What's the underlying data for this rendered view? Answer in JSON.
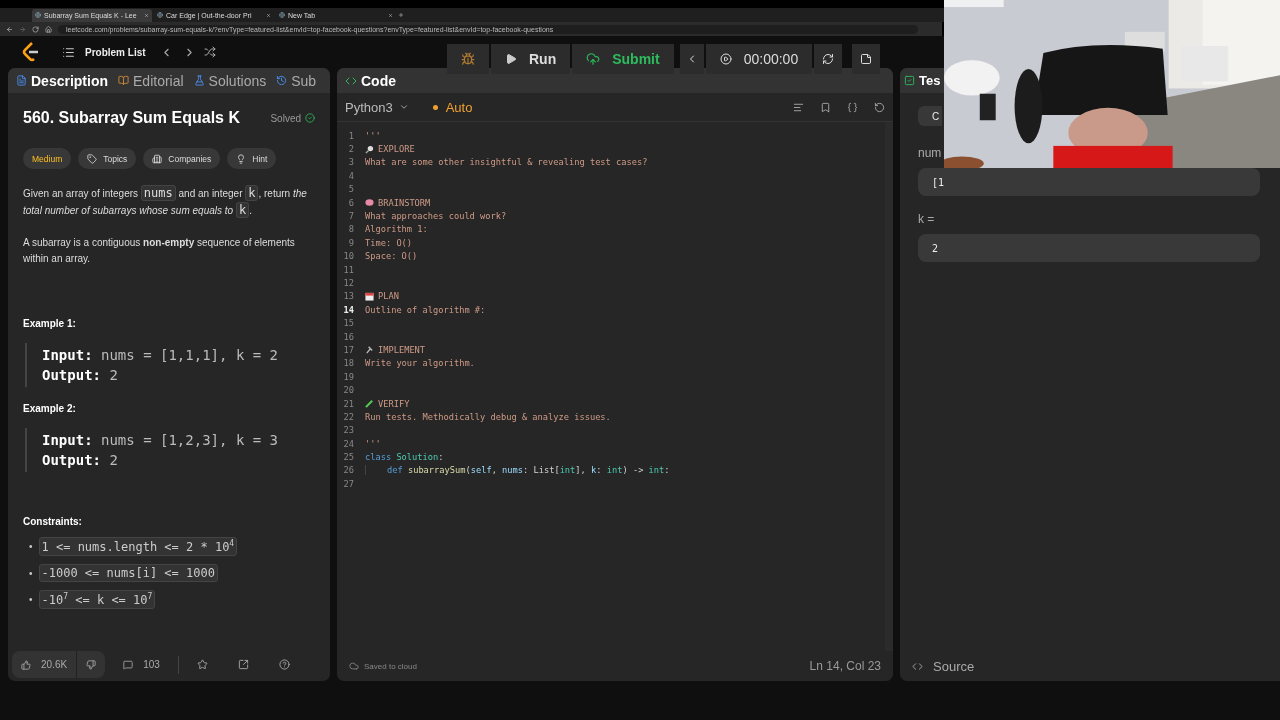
{
  "browser": {
    "tabs": [
      {
        "title": "Subarray Sum Equals K - Lee",
        "selected": true
      },
      {
        "title": "Car Edge | Out-the-door Pri",
        "selected": false
      },
      {
        "title": "New Tab",
        "selected": false
      }
    ],
    "url": "leetcode.com/problems/subarray-sum-equals-k/?envType=featured-list&envId=top-facebook-questions?envType=featured-list&envId=top-facebook-questions"
  },
  "header": {
    "problem_list": "Problem List"
  },
  "toolbar": {
    "run": "Run",
    "submit": "Submit",
    "timer": "00:00:00"
  },
  "description_panel": {
    "tabs": [
      {
        "label": "Description",
        "selected": true
      },
      {
        "label": "Editorial",
        "selected": false
      },
      {
        "label": "Solutions",
        "selected": false
      },
      {
        "label": "Sub",
        "selected": false
      }
    ],
    "title": "560. Subarray Sum Equals K",
    "status": "Solved",
    "tags": [
      {
        "label": "Medium",
        "kind": "difficulty"
      },
      {
        "label": "Topics",
        "kind": "topics"
      },
      {
        "label": "Companies",
        "kind": "companies"
      },
      {
        "label": "Hint",
        "kind": "hint"
      }
    ],
    "paragraphs": [
      [
        {
          "text": "Given an array of integers ",
          "kind": "text"
        },
        {
          "text": "nums",
          "kind": "code"
        },
        {
          "text": " and an integer ",
          "kind": "text"
        },
        {
          "text": "k",
          "kind": "code"
        },
        {
          "text": ", return ",
          "kind": "text"
        },
        {
          "text": "the total number of subarrays whose sum equals to ",
          "kind": "italic"
        },
        {
          "text": "k",
          "kind": "code"
        },
        {
          "text": ".",
          "kind": "text"
        }
      ],
      [
        {
          "text": "A subarray is a contiguous ",
          "kind": "text"
        },
        {
          "text": "non-empty",
          "kind": "bold"
        },
        {
          "text": " sequence of elements within an array.",
          "kind": "text"
        }
      ]
    ],
    "examples": [
      {
        "heading": "Example 1:",
        "input_label": "Input:",
        "input": "nums = [1,1,1], k = 2",
        "output_label": "Output:",
        "output": "2"
      },
      {
        "heading": "Example 2:",
        "input_label": "Input:",
        "input": "nums = [1,2,3], k = 3",
        "output_label": "Output:",
        "output": "2"
      }
    ],
    "constraints_heading": "Constraints:",
    "constraints": [
      {
        "bullet": "•",
        "text": "1 <= nums.length <= 2 * 10$^{4}$"
      },
      {
        "bullet": "•",
        "text": "-1000 <= nums[i] <= 1000"
      },
      {
        "bullet": "•",
        "text": "-10$^{7}$ <= k <= 10$^{7}$"
      }
    ],
    "footer": {
      "likes": "20.6K",
      "comments": "103"
    }
  },
  "code_panel": {
    "title": "Code",
    "language": "Python3",
    "mode": "Auto",
    "lines": [
      {
        "n": "1",
        "kind": "comment",
        "current": false,
        "text": "'''"
      },
      {
        "n": "2",
        "kind": "heading",
        "current": false,
        "text": "EXPLORE"
      },
      {
        "n": "3",
        "kind": "comment",
        "current": false,
        "text": "What are some other insightful & revealing test cases?"
      },
      {
        "n": "4",
        "kind": "blank",
        "current": false
      },
      {
        "n": "5",
        "kind": "blank",
        "current": false
      },
      {
        "n": "6",
        "kind": "heading",
        "current": false,
        "text": "BRAINSTORM"
      },
      {
        "n": "7",
        "kind": "comment",
        "current": false,
        "text": "What approaches could work?"
      },
      {
        "n": "8",
        "kind": "comment",
        "current": false,
        "text": "Algorithm 1:"
      },
      {
        "n": "9",
        "kind": "comment",
        "current": false,
        "text": "Time: O()"
      },
      {
        "n": "10",
        "kind": "comment",
        "current": false,
        "text": "Space: O()"
      },
      {
        "n": "11",
        "kind": "blank",
        "current": false
      },
      {
        "n": "12",
        "kind": "blank",
        "current": false
      },
      {
        "n": "13",
        "kind": "heading",
        "current": false,
        "text": "PLAN"
      },
      {
        "n": "14",
        "kind": "comment",
        "current": true,
        "text": "Outline of algorithm #:"
      },
      {
        "n": "15",
        "kind": "blank",
        "current": false
      },
      {
        "n": "16",
        "kind": "blank",
        "current": false
      },
      {
        "n": "17",
        "kind": "heading",
        "current": false,
        "text": "IMPLEMENT"
      },
      {
        "n": "18",
        "kind": "comment",
        "current": false,
        "text": "Write your algorithm."
      },
      {
        "n": "19",
        "kind": "blank",
        "current": false
      },
      {
        "n": "20",
        "kind": "blank",
        "current": false
      },
      {
        "n": "21",
        "kind": "heading",
        "current": false,
        "text": "VERIFY"
      },
      {
        "n": "22",
        "kind": "comment",
        "current": false,
        "text": "Run tests. Methodically debug & analyze issues."
      },
      {
        "n": "23",
        "kind": "blank",
        "current": false
      },
      {
        "n": "24",
        "kind": "comment",
        "current": false,
        "text": "'''"
      },
      {
        "n": "25",
        "kind": "code",
        "current": false,
        "tokens": [
          {
            "t": "class",
            "kind": "keyword"
          },
          {
            "t": " Solution",
            "kind": "type"
          },
          {
            "t": ":",
            "kind": "plain"
          }
        ]
      },
      {
        "n": "26",
        "kind": "indented",
        "current": false,
        "tokens": [
          {
            "t": "def",
            "kind": "keyword"
          },
          {
            "t": " subarraySum",
            "kind": "function"
          },
          {
            "t": "(",
            "kind": "plain"
          },
          {
            "t": "self",
            "kind": "param"
          },
          {
            "t": ", ",
            "kind": "plain"
          },
          {
            "t": "nums",
            "kind": "param"
          },
          {
            "t": ": List[",
            "kind": "plain"
          },
          {
            "t": "int",
            "kind": "type"
          },
          {
            "t": "], ",
            "kind": "plain"
          },
          {
            "t": "k",
            "kind": "param"
          },
          {
            "t": ": ",
            "kind": "plain"
          },
          {
            "t": "int",
            "kind": "type"
          },
          {
            "t": ") -> ",
            "kind": "plain"
          },
          {
            "t": "int",
            "kind": "type"
          },
          {
            "t": ":",
            "kind": "plain"
          }
        ]
      },
      {
        "n": "27",
        "kind": "blank",
        "current": false
      }
    ],
    "save_status": "Saved to cloud",
    "cursor": "Ln 14, Col 23"
  },
  "testcase_panel": {
    "tab": "Tes",
    "case": "C",
    "fields": [
      {
        "label": "num",
        "value": "[1"
      },
      {
        "label": "k =",
        "value": "2"
      }
    ],
    "source": "Source"
  }
}
